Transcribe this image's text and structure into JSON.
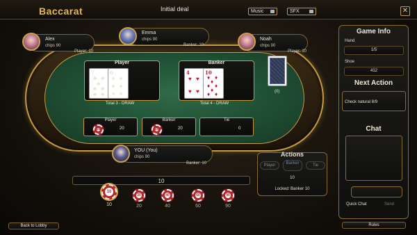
{
  "header": {
    "title": "Baccarat",
    "phase": "Initial deal",
    "music_label": "Music",
    "sfx_label": "SFX",
    "close_label": "✕"
  },
  "players": [
    {
      "name": "Alex",
      "chips": "chips 90",
      "seat_info": "Player: 10"
    },
    {
      "name": "Emma",
      "chips": "chips 90",
      "seat_info": "Banker: 10"
    },
    {
      "name": "Noah",
      "chips": "chips 90",
      "seat_info": "Player: 10"
    }
  ],
  "you": {
    "name": "YOU (You)",
    "chips": "chips 90",
    "seat_info": "Banker: 10"
  },
  "hands": {
    "player": {
      "label": "Player",
      "total": "Total 3 - DRAW",
      "cards": [
        {
          "rank": "7",
          "suit": "♣",
          "color": "#111"
        },
        {
          "rank": "6",
          "suit": "♠",
          "color": "#111"
        }
      ]
    },
    "banker": {
      "label": "Banker",
      "total": "Total 4 - DRAW",
      "cards": [
        {
          "rank": "4",
          "suit": "♥",
          "color": "#c8102e"
        },
        {
          "rank": "10",
          "suit": "♦",
          "color": "#c8102e"
        }
      ]
    }
  },
  "shoe_count": "(0)",
  "bets": [
    {
      "name": "Player",
      "amount": "20",
      "chip": "20"
    },
    {
      "name": "Banker",
      "amount": "20",
      "chip": "20"
    },
    {
      "name": "Tie",
      "amount": "0"
    }
  ],
  "current_bet": "10",
  "chips": [
    {
      "value": "10",
      "label": "10"
    },
    {
      "value": "20",
      "label": "20"
    },
    {
      "value": "40",
      "label": "40"
    },
    {
      "value": "60",
      "label": "60"
    },
    {
      "value": "90",
      "label": "90"
    }
  ],
  "actions": {
    "title": "Actions",
    "buttons": [
      "Player",
      "Banker",
      "Tie"
    ],
    "amount": "10",
    "locked": "Locked: Banker 10"
  },
  "sidebar": {
    "game_info_title": "Game Info",
    "hand_label": "Hand",
    "hand_value": "1/5",
    "shoe_label": "Shoe",
    "shoe_value": "412",
    "next_action_title": "Next Action",
    "next_action_text": "Check natural 8/9",
    "chat_title": "Chat",
    "quick_chat": "Quick Chat",
    "send": "Send"
  },
  "footer": {
    "back": "Back to Lobby",
    "rules": "Rules"
  }
}
